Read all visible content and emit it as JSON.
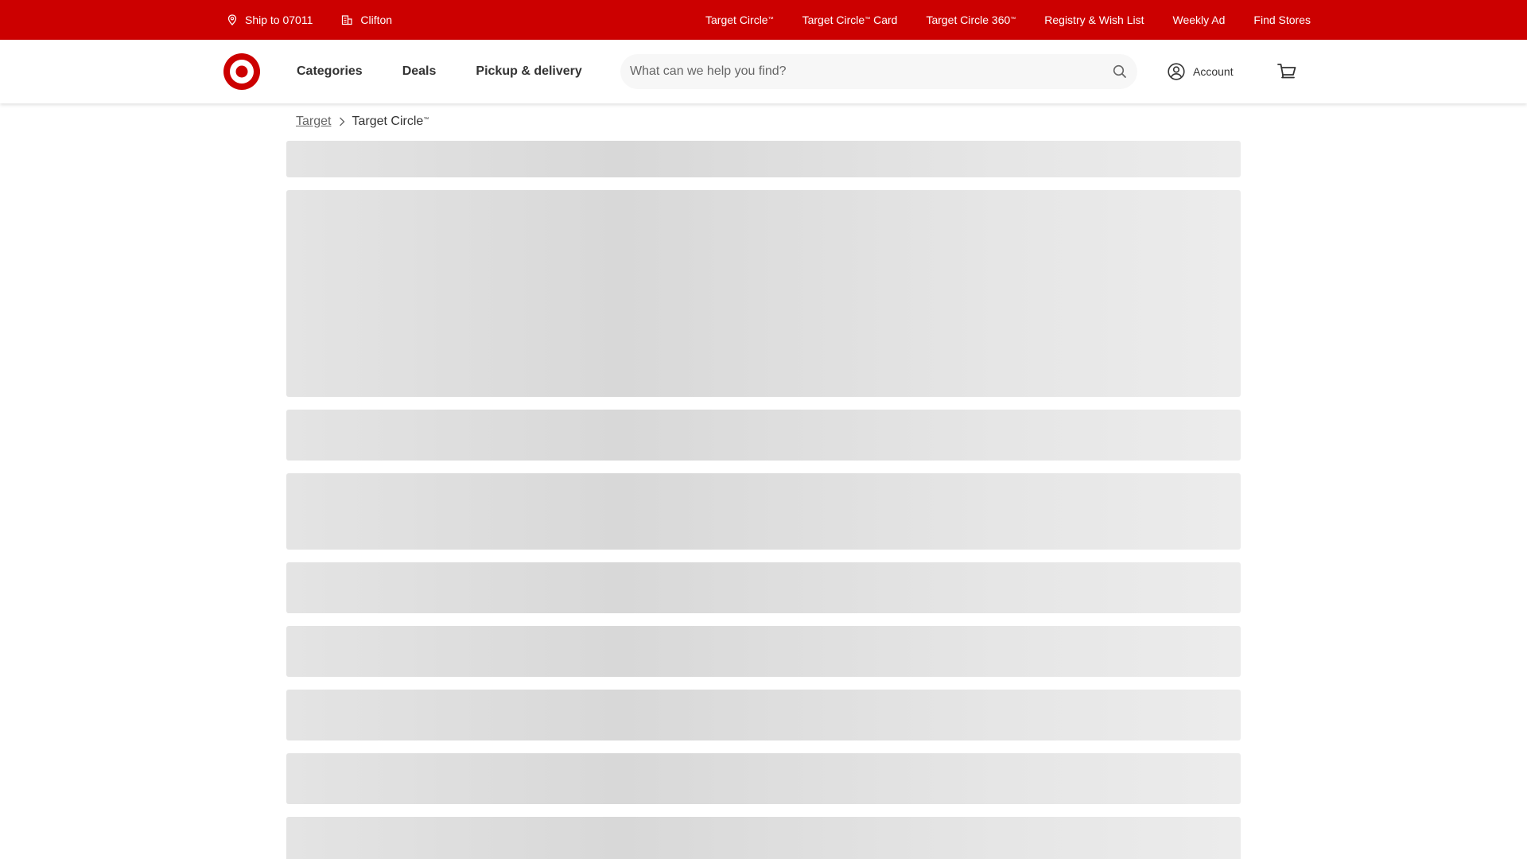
{
  "utility_bar": {
    "ship_to": "Ship to 07011",
    "store": "Clifton",
    "links": [
      {
        "label": "Target Circle",
        "mark": "™"
      },
      {
        "label": "Target Circle",
        "mark": "™",
        "suffix": " Card"
      },
      {
        "label": "Target Circle 360",
        "mark": "™"
      },
      {
        "label": "Registry & Wish List",
        "mark": ""
      },
      {
        "label": "Weekly Ad",
        "mark": ""
      },
      {
        "label": "Find Stores",
        "mark": ""
      }
    ]
  },
  "header": {
    "logo_icon": "target-bullseye-logo",
    "nav": [
      "Categories",
      "Deals",
      "Pickup & delivery"
    ],
    "search_placeholder": "What can we help you find?",
    "account_label": "Account",
    "cart_icon": "cart-icon"
  },
  "breadcrumb": {
    "root": "Target",
    "current": "Target Circle",
    "current_mark": "™"
  },
  "content": {
    "state": "loading",
    "placeholder_count": 10
  },
  "colors": {
    "brand_red": "#cc0000",
    "skeleton": "#dcdcdc"
  }
}
